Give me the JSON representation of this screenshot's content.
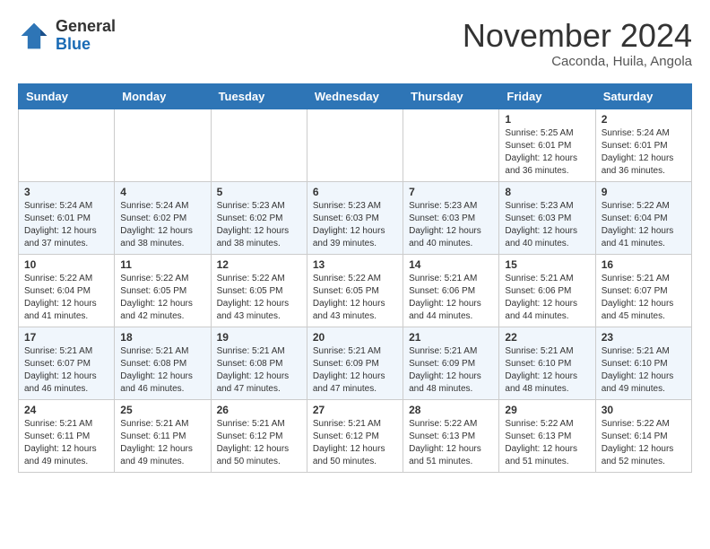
{
  "header": {
    "logo": {
      "general": "General",
      "blue": "Blue"
    },
    "title": "November 2024",
    "location": "Caconda, Huila, Angola"
  },
  "weekdays": [
    "Sunday",
    "Monday",
    "Tuesday",
    "Wednesday",
    "Thursday",
    "Friday",
    "Saturday"
  ],
  "weeks": [
    [
      {
        "day": null,
        "info": null
      },
      {
        "day": null,
        "info": null
      },
      {
        "day": null,
        "info": null
      },
      {
        "day": null,
        "info": null
      },
      {
        "day": null,
        "info": null
      },
      {
        "day": "1",
        "info": "Sunrise: 5:25 AM\nSunset: 6:01 PM\nDaylight: 12 hours\nand 36 minutes."
      },
      {
        "day": "2",
        "info": "Sunrise: 5:24 AM\nSunset: 6:01 PM\nDaylight: 12 hours\nand 36 minutes."
      }
    ],
    [
      {
        "day": "3",
        "info": "Sunrise: 5:24 AM\nSunset: 6:01 PM\nDaylight: 12 hours\nand 37 minutes."
      },
      {
        "day": "4",
        "info": "Sunrise: 5:24 AM\nSunset: 6:02 PM\nDaylight: 12 hours\nand 38 minutes."
      },
      {
        "day": "5",
        "info": "Sunrise: 5:23 AM\nSunset: 6:02 PM\nDaylight: 12 hours\nand 38 minutes."
      },
      {
        "day": "6",
        "info": "Sunrise: 5:23 AM\nSunset: 6:03 PM\nDaylight: 12 hours\nand 39 minutes."
      },
      {
        "day": "7",
        "info": "Sunrise: 5:23 AM\nSunset: 6:03 PM\nDaylight: 12 hours\nand 40 minutes."
      },
      {
        "day": "8",
        "info": "Sunrise: 5:23 AM\nSunset: 6:03 PM\nDaylight: 12 hours\nand 40 minutes."
      },
      {
        "day": "9",
        "info": "Sunrise: 5:22 AM\nSunset: 6:04 PM\nDaylight: 12 hours\nand 41 minutes."
      }
    ],
    [
      {
        "day": "10",
        "info": "Sunrise: 5:22 AM\nSunset: 6:04 PM\nDaylight: 12 hours\nand 41 minutes."
      },
      {
        "day": "11",
        "info": "Sunrise: 5:22 AM\nSunset: 6:05 PM\nDaylight: 12 hours\nand 42 minutes."
      },
      {
        "day": "12",
        "info": "Sunrise: 5:22 AM\nSunset: 6:05 PM\nDaylight: 12 hours\nand 43 minutes."
      },
      {
        "day": "13",
        "info": "Sunrise: 5:22 AM\nSunset: 6:05 PM\nDaylight: 12 hours\nand 43 minutes."
      },
      {
        "day": "14",
        "info": "Sunrise: 5:21 AM\nSunset: 6:06 PM\nDaylight: 12 hours\nand 44 minutes."
      },
      {
        "day": "15",
        "info": "Sunrise: 5:21 AM\nSunset: 6:06 PM\nDaylight: 12 hours\nand 44 minutes."
      },
      {
        "day": "16",
        "info": "Sunrise: 5:21 AM\nSunset: 6:07 PM\nDaylight: 12 hours\nand 45 minutes."
      }
    ],
    [
      {
        "day": "17",
        "info": "Sunrise: 5:21 AM\nSunset: 6:07 PM\nDaylight: 12 hours\nand 46 minutes."
      },
      {
        "day": "18",
        "info": "Sunrise: 5:21 AM\nSunset: 6:08 PM\nDaylight: 12 hours\nand 46 minutes."
      },
      {
        "day": "19",
        "info": "Sunrise: 5:21 AM\nSunset: 6:08 PM\nDaylight: 12 hours\nand 47 minutes."
      },
      {
        "day": "20",
        "info": "Sunrise: 5:21 AM\nSunset: 6:09 PM\nDaylight: 12 hours\nand 47 minutes."
      },
      {
        "day": "21",
        "info": "Sunrise: 5:21 AM\nSunset: 6:09 PM\nDaylight: 12 hours\nand 48 minutes."
      },
      {
        "day": "22",
        "info": "Sunrise: 5:21 AM\nSunset: 6:10 PM\nDaylight: 12 hours\nand 48 minutes."
      },
      {
        "day": "23",
        "info": "Sunrise: 5:21 AM\nSunset: 6:10 PM\nDaylight: 12 hours\nand 49 minutes."
      }
    ],
    [
      {
        "day": "24",
        "info": "Sunrise: 5:21 AM\nSunset: 6:11 PM\nDaylight: 12 hours\nand 49 minutes."
      },
      {
        "day": "25",
        "info": "Sunrise: 5:21 AM\nSunset: 6:11 PM\nDaylight: 12 hours\nand 49 minutes."
      },
      {
        "day": "26",
        "info": "Sunrise: 5:21 AM\nSunset: 6:12 PM\nDaylight: 12 hours\nand 50 minutes."
      },
      {
        "day": "27",
        "info": "Sunrise: 5:21 AM\nSunset: 6:12 PM\nDaylight: 12 hours\nand 50 minutes."
      },
      {
        "day": "28",
        "info": "Sunrise: 5:22 AM\nSunset: 6:13 PM\nDaylight: 12 hours\nand 51 minutes."
      },
      {
        "day": "29",
        "info": "Sunrise: 5:22 AM\nSunset: 6:13 PM\nDaylight: 12 hours\nand 51 minutes."
      },
      {
        "day": "30",
        "info": "Sunrise: 5:22 AM\nSunset: 6:14 PM\nDaylight: 12 hours\nand 52 minutes."
      }
    ]
  ]
}
